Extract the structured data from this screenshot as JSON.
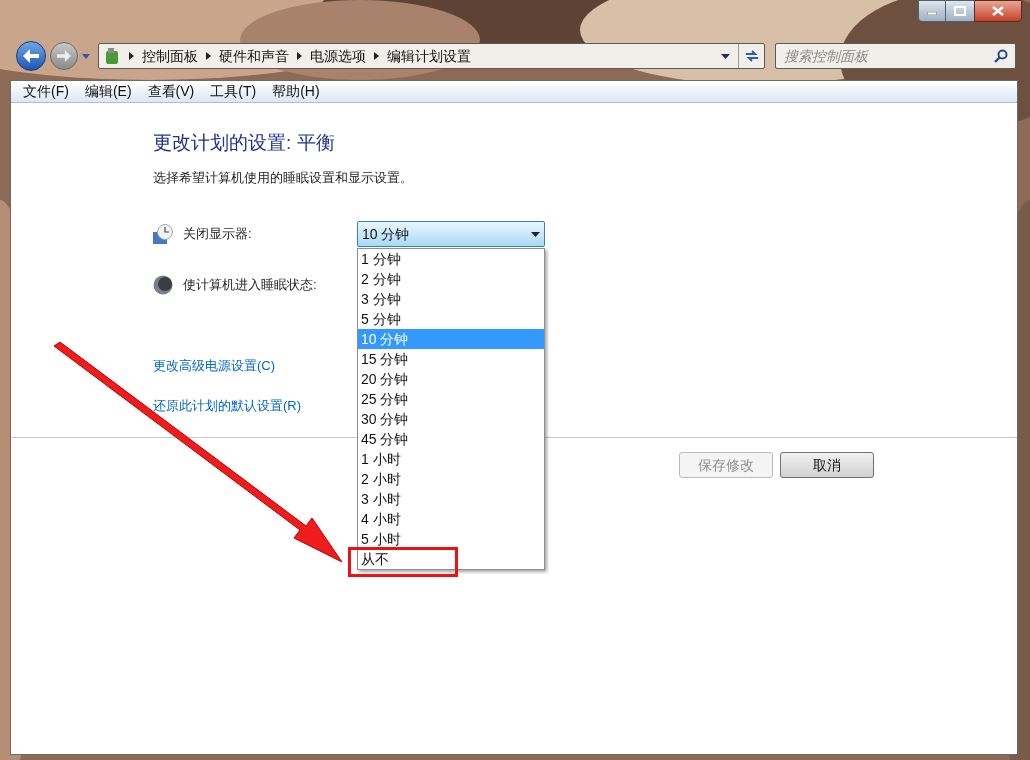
{
  "address_bar": {
    "breadcrumbs": [
      "控制面板",
      "硬件和声音",
      "电源选项",
      "编辑计划设置"
    ],
    "search": {
      "placeholder": "搜索控制面板"
    }
  },
  "menu_bar": [
    "文件(F)",
    "编辑(E)",
    "查看(V)",
    "工具(T)",
    "帮助(H)"
  ],
  "heading": "更改计划的设置: 平衡",
  "description": "选择希望计算机使用的睡眠设置和显示设置。",
  "settings": [
    {
      "kind": "display",
      "label": "关闭显示器:",
      "value": "10 分钟",
      "expanded": true
    },
    {
      "kind": "sleep",
      "label": "使计算机进入睡眠状态:"
    }
  ],
  "dropdown_options": [
    {
      "label": "1 分钟",
      "selected": false,
      "highlighted": false
    },
    {
      "label": "2 分钟",
      "selected": false,
      "highlighted": false
    },
    {
      "label": "3 分钟",
      "selected": false,
      "highlighted": false
    },
    {
      "label": "5 分钟",
      "selected": false,
      "highlighted": false
    },
    {
      "label": "10 分钟",
      "selected": true,
      "highlighted": false
    },
    {
      "label": "15 分钟",
      "selected": false,
      "highlighted": false
    },
    {
      "label": "20 分钟",
      "selected": false,
      "highlighted": false
    },
    {
      "label": "25 分钟",
      "selected": false,
      "highlighted": false
    },
    {
      "label": "30 分钟",
      "selected": false,
      "highlighted": false
    },
    {
      "label": "45 分钟",
      "selected": false,
      "highlighted": false
    },
    {
      "label": "1 小时",
      "selected": false,
      "highlighted": false
    },
    {
      "label": "2 小时",
      "selected": false,
      "highlighted": false
    },
    {
      "label": "3 小时",
      "selected": false,
      "highlighted": false
    },
    {
      "label": "4 小时",
      "selected": false,
      "highlighted": false
    },
    {
      "label": "5 小时",
      "selected": false,
      "highlighted": false
    },
    {
      "label": "从不",
      "selected": false,
      "highlighted": true
    }
  ],
  "links": [
    "更改高级电源设置(C)",
    "还原此计划的默认设置(R)"
  ],
  "buttons": [
    {
      "label": "保存修改",
      "disabled": true
    },
    {
      "label": "取消",
      "disabled": false
    }
  ]
}
